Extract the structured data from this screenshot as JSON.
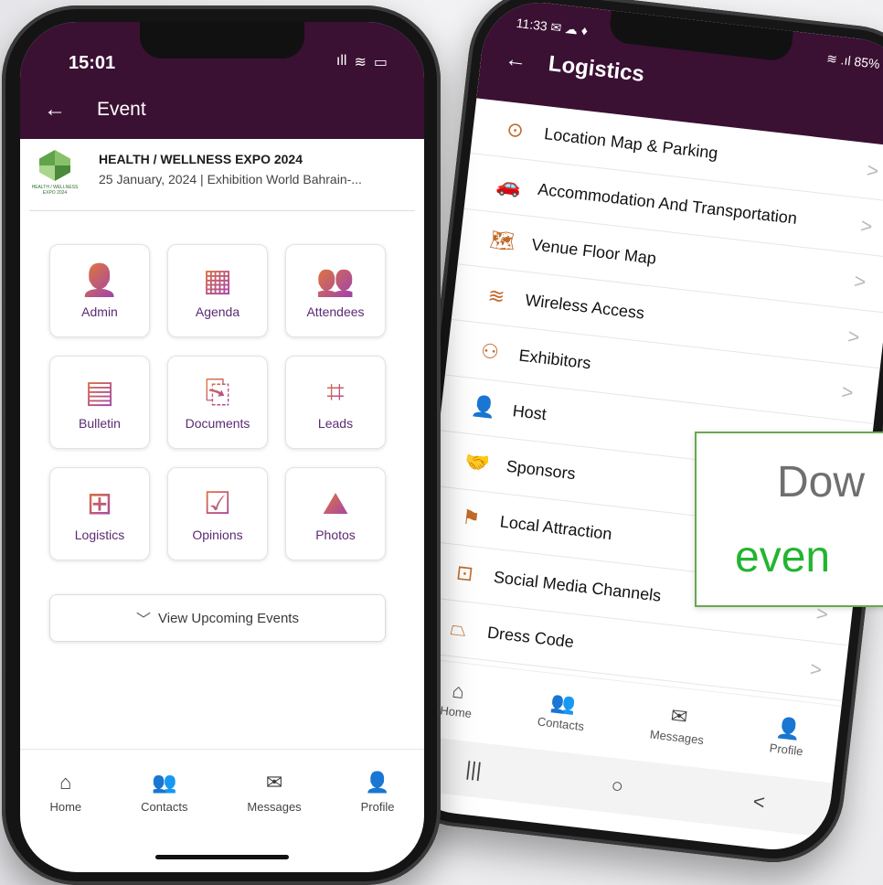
{
  "banner": {
    "line1": "Dow",
    "line2": "even"
  },
  "phone_left": {
    "status": {
      "time": "15:01",
      "signal": "ıll",
      "wifi": "≋",
      "battery": "▭"
    },
    "header": {
      "back": "←",
      "title": "Event"
    },
    "event": {
      "logo_text_top": "HEALTH / WELLNESS",
      "logo_text_bottom": "EXPO 2024",
      "name": "HEALTH / WELLNESS EXPO 2024",
      "details": "25 January, 2024 | Exhibition World Bahrain-..."
    },
    "tiles": [
      {
        "label": "Admin",
        "icon": "👤"
      },
      {
        "label": "Agenda",
        "icon": "▦"
      },
      {
        "label": "Attendees",
        "icon": "👥"
      },
      {
        "label": "Bulletin",
        "icon": "▤"
      },
      {
        "label": "Documents",
        "icon": "⎘"
      },
      {
        "label": "Leads",
        "icon": "⌗"
      },
      {
        "label": "Logistics",
        "icon": "⊞"
      },
      {
        "label": "Opinions",
        "icon": "☑"
      },
      {
        "label": "Photos",
        "icon": "⛰"
      }
    ],
    "upcoming": {
      "chevron": "﹀",
      "label": "View Upcoming Events"
    },
    "tabs": [
      {
        "label": "Home",
        "icon": "⌂"
      },
      {
        "label": "Contacts",
        "icon": "👥"
      },
      {
        "label": "Messages",
        "icon": "✉"
      },
      {
        "label": "Profile",
        "icon": "👤"
      }
    ]
  },
  "phone_right": {
    "status": {
      "time": "11:33",
      "icons": "✉ ☁ ♦",
      "right": "≋ .ıl 85%"
    },
    "header": {
      "back": "←",
      "title": "Logistics"
    },
    "items": [
      {
        "label": "Location Map & Parking",
        "icon": "⊙",
        "chevron": ">"
      },
      {
        "label": "Accommodation And Transportation",
        "icon": "🚗",
        "chevron": ">"
      },
      {
        "label": "Venue Floor Map",
        "icon": "🗺",
        "chevron": ">"
      },
      {
        "label": "Wireless Access",
        "icon": "≋",
        "chevron": ">"
      },
      {
        "label": "Exhibitors",
        "icon": "⚇",
        "chevron": ">"
      },
      {
        "label": "Host",
        "icon": "👤",
        "chevron": ">"
      },
      {
        "label": "Sponsors",
        "icon": "🤝",
        "chevron": ">"
      },
      {
        "label": "Local Attraction",
        "icon": "⚑",
        "chevron": ">"
      },
      {
        "label": "Social Media Channels",
        "icon": "⊡",
        "chevron": ">"
      },
      {
        "label": "Dress Code",
        "icon": "⏢",
        "chevron": ">"
      }
    ],
    "tabs": [
      {
        "label": "Home",
        "icon": "⌂"
      },
      {
        "label": "Contacts",
        "icon": "👥"
      },
      {
        "label": "Messages",
        "icon": "✉"
      },
      {
        "label": "Profile",
        "icon": "👤"
      }
    ],
    "system_nav": {
      "recents": "|||",
      "home": "○",
      "back": "<"
    }
  }
}
